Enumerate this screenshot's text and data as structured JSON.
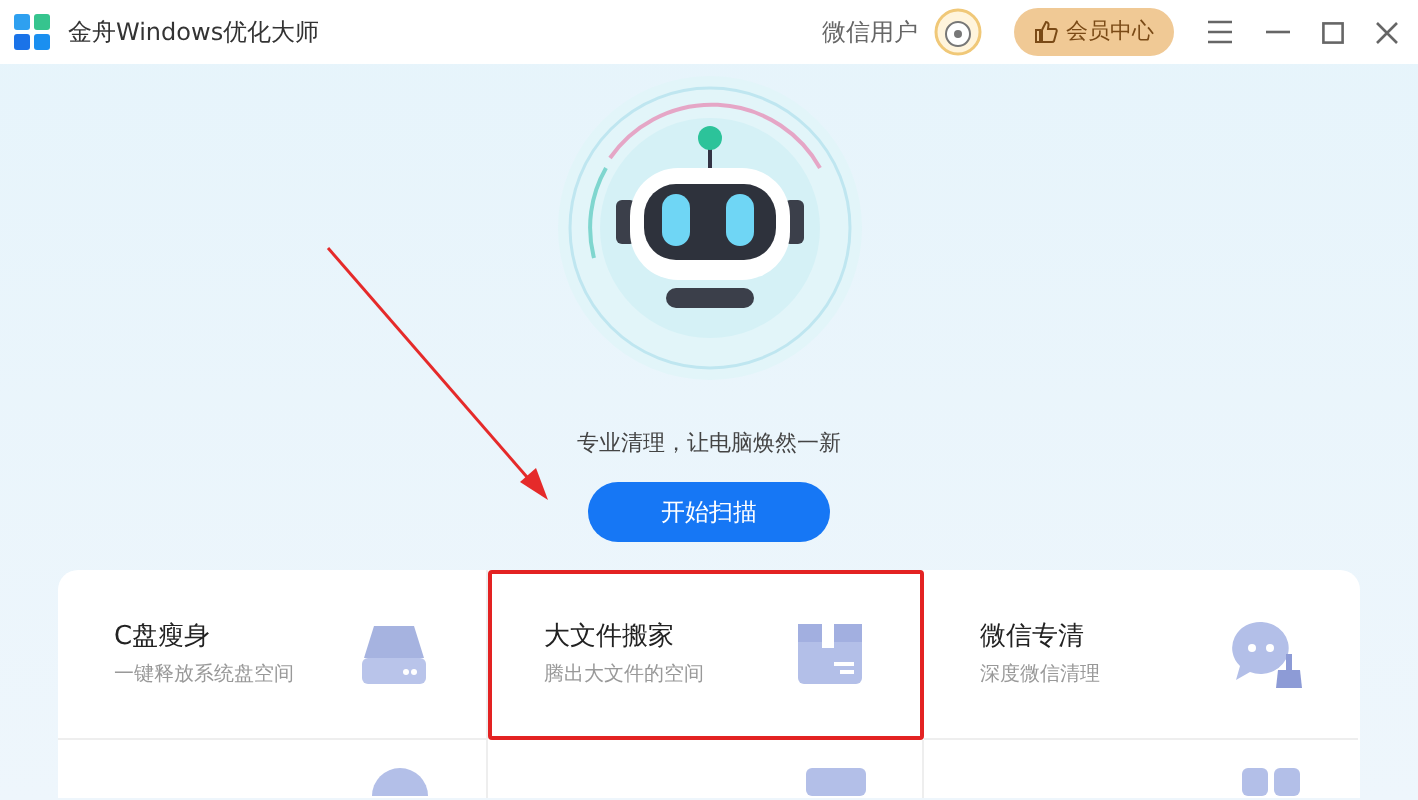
{
  "window": {
    "title": "金舟Windows优化大师",
    "user": "微信用户",
    "vip_button": "会员中心"
  },
  "hero": {
    "tagline": "专业清理，让电脑焕然一新",
    "scan_button": "开始扫描"
  },
  "tools": [
    {
      "title": "C盘瘦身",
      "subtitle": "一键释放系统盘空间",
      "kind": "drive",
      "highlighted": false
    },
    {
      "title": "大文件搬家",
      "subtitle": "腾出大文件的空间",
      "kind": "box",
      "highlighted": true
    },
    {
      "title": "微信专清",
      "subtitle": "深度微信清理",
      "kind": "chat",
      "highlighted": false
    }
  ]
}
